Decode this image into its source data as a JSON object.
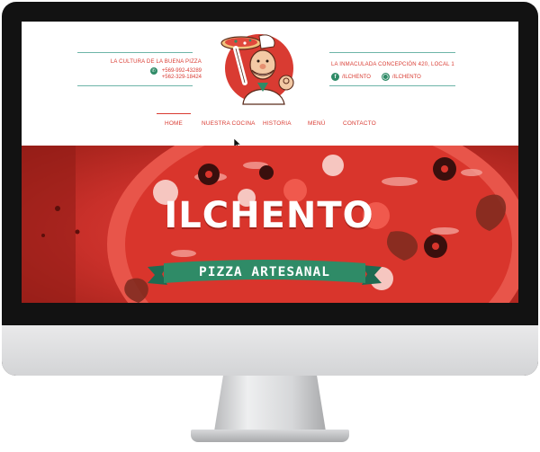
{
  "header": {
    "tagline": "LA CULTURA DE LA BUENA PIZZA",
    "phone_1": "+569-992-43289",
    "phone_2": "+562-329-18424",
    "address": "LA INMACULADA CONCEPCIÓN 420, LOCAL 1",
    "facebook": "/ILCHENTO",
    "instagram": "/ILCHENTO",
    "icons": {
      "phone": "whatsapp-icon",
      "facebook": "facebook-icon",
      "instagram": "instagram-icon",
      "logo": "chef-mascot-logo"
    }
  },
  "nav": {
    "items": [
      {
        "label": "HOME",
        "active": true
      },
      {
        "label": "NUESTRA COCINA",
        "active": false
      },
      {
        "label": "HISTORIA",
        "active": false
      },
      {
        "label": "MENÚ",
        "active": false
      },
      {
        "label": "CONTACTO",
        "active": false
      }
    ]
  },
  "hero": {
    "brand": "ILCHENTO",
    "subtitle": "PIZZA ARTESANAL"
  },
  "colors": {
    "accent_red": "#d93b32",
    "accent_green": "#2f8b67",
    "rule_teal": "#6db5a8",
    "hero_red": "#c9302a"
  }
}
